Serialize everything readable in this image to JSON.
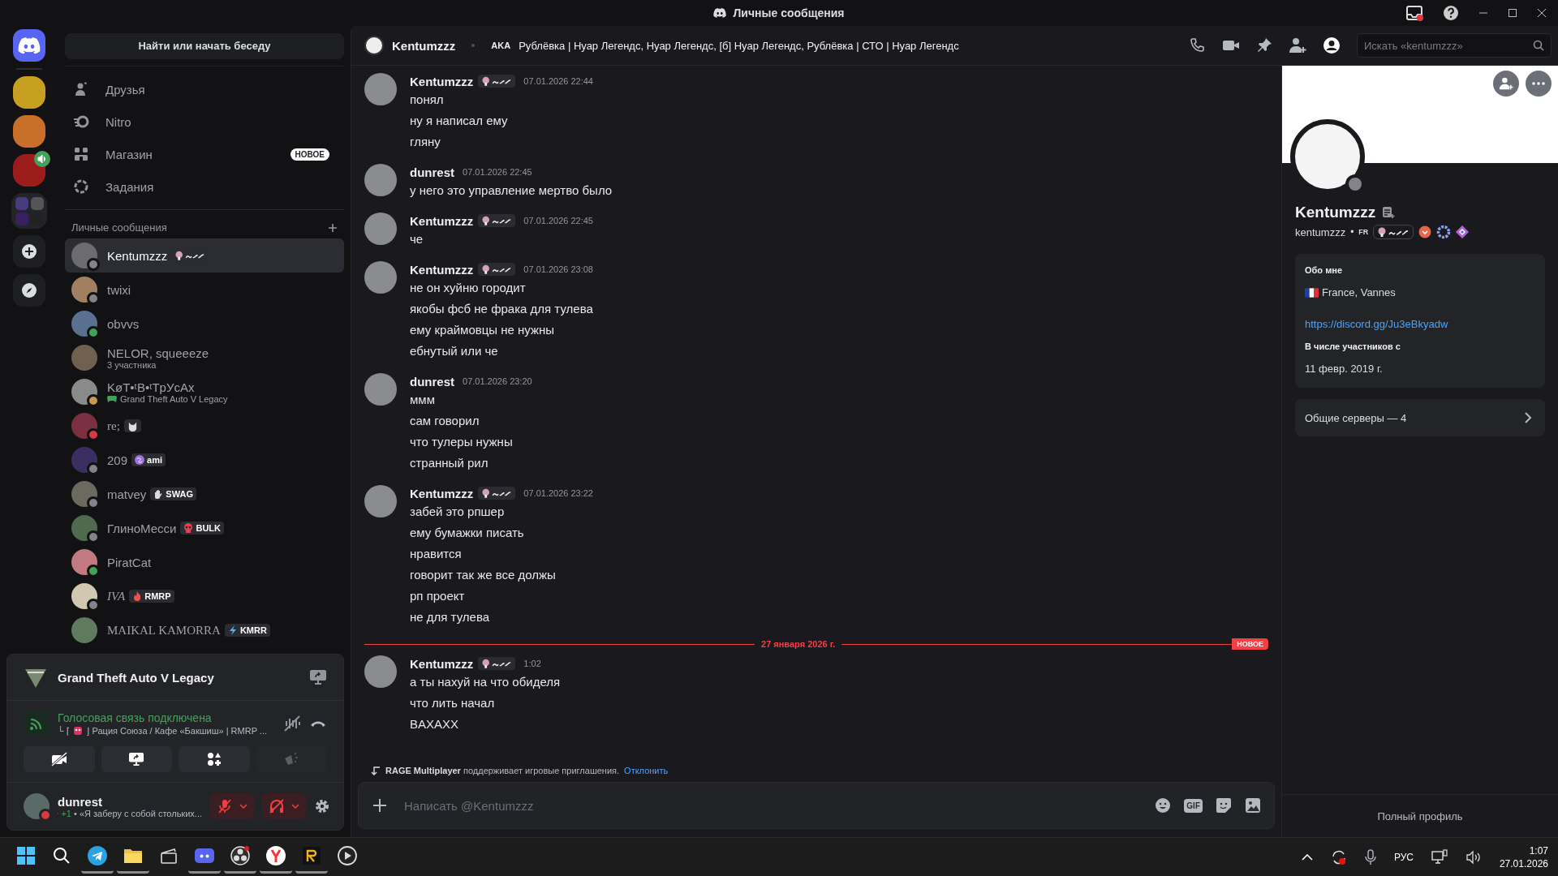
{
  "titlebar": {
    "title": "Личные сообщения"
  },
  "rail": [
    {
      "kind": "home",
      "selected": true
    },
    {
      "kind": "server",
      "selected": false,
      "voice": false
    },
    {
      "kind": "server",
      "selected": false,
      "voice": false
    },
    {
      "kind": "server",
      "selected": false,
      "voice": true
    },
    {
      "kind": "folder",
      "selected": false
    },
    {
      "kind": "add"
    },
    {
      "kind": "explore"
    }
  ],
  "sidebar": {
    "search_button": "Найти или начать беседу",
    "nav": [
      {
        "kind": "friends",
        "label": "Друзья"
      },
      {
        "kind": "nitro",
        "label": "Nitro"
      },
      {
        "kind": "shop",
        "label": "Магазин",
        "badge": "НОВОЕ"
      },
      {
        "kind": "quests",
        "label": "Задания"
      }
    ],
    "dm_header": "Личные сообщения",
    "dms": [
      {
        "kind": "plain",
        "name": "Kentumzzz",
        "tag": {
          "kind": "emblem"
        },
        "color": "#82838b",
        "selected": true
      },
      {
        "kind": "plain",
        "name": "twixi",
        "color": "#82838b",
        "selected": false
      },
      {
        "kind": "plain",
        "name": "obvvs",
        "color": "#43a25a",
        "selected": false
      },
      {
        "kind": "plain",
        "name": "NELOR, squeeeze",
        "subtitle": "3 участника",
        "selected": false
      },
      {
        "kind": "plain",
        "name": "KøT•ᵗB•ᵗTpУcAx",
        "subtitle": "Grand Theft Auto V Legacy",
        "color": "#ca9654",
        "selected": false
      },
      {
        "kind": "serif",
        "name": "re;",
        "tag": {
          "kind": "cat"
        },
        "color": "#d83a42",
        "selected": false
      },
      {
        "kind": "plain",
        "name": "209",
        "tag": {
          "kind": "swirl",
          "label": "ami"
        },
        "color": "#82838b",
        "selected": false
      },
      {
        "kind": "plain",
        "name": "matvey",
        "tag": {
          "kind": "hand",
          "label": "SWAG"
        },
        "color": "#82838b",
        "selected": false
      },
      {
        "kind": "plain",
        "name": "ГлиноМесси",
        "tag": {
          "kind": "skull",
          "label": "BULK"
        },
        "color": "#82838b",
        "selected": false
      },
      {
        "kind": "plain",
        "name": "PiratCat",
        "color": "#43a25a",
        "selected": false
      },
      {
        "kind": "italic",
        "name": "IVA",
        "tag": {
          "kind": "flame",
          "label": "RMRP"
        },
        "color": "#82838b",
        "selected": false
      },
      {
        "kind": "serif",
        "name": "MAIKAL KAMORRA",
        "tag": {
          "kind": "bolt",
          "label": "KMRR"
        },
        "selected": false
      }
    ]
  },
  "activity": {
    "game": "Grand Theft Auto V Legacy",
    "voice_status": "Голосовая связь подключена",
    "channel_prefix": "└ ⌈",
    "channel_suffix": "⌋ Рация Союза / Кафе «Бакшиш» | RMRP ..."
  },
  "user": {
    "name": "dunrest",
    "color": "#d83a42",
    "activity_count": "+1",
    "custom_status": "• «Я заберу с собой стольких...",
    "mic_muted": true,
    "deafened": true
  },
  "chat_header": {
    "name": "Kentumzzz",
    "aka_label": "AKA",
    "aka": "Рублёвка | Нуар Легендс, Нуар Легендс, [б] Нуар Легендс, Рублёвка | СТО | Нуар Легендс",
    "search_placeholder": "Искать «kentumzzz»",
    "profile_open": true
  },
  "messages": [
    {
      "author": "Kentumzzz",
      "tag_emblem": true,
      "time": "07.01.2026 22:44",
      "lines": [
        "понял",
        "ну я написал ему",
        "гляну"
      ]
    },
    {
      "author": "dunrest",
      "tag_emblem": false,
      "time": "07.01.2026 22:45",
      "lines": [
        "у него это управление мертво было"
      ]
    },
    {
      "author": "Kentumzzz",
      "tag_emblem": true,
      "time": "07.01.2026 22:45",
      "lines": [
        "че"
      ]
    },
    {
      "author": "Kentumzzz",
      "tag_emblem": true,
      "time": "07.01.2026 23:08",
      "lines": [
        "не он хуйню городит",
        "якобы фсб не фрака для тулева",
        "ему краймовцы не нужны",
        "ебнутый или че"
      ]
    },
    {
      "author": "dunrest",
      "tag_emblem": false,
      "time": "07.01.2026 23:20",
      "lines": [
        "ммм",
        "сам говорил",
        "что тулеры нужны",
        "странный рил"
      ]
    },
    {
      "author": "Kentumzzz",
      "tag_emblem": true,
      "time": "07.01.2026 23:22",
      "lines": [
        "забей это рпшер",
        "ему бумажки писать",
        "нравится",
        "говорит так же все должы",
        "рп проект",
        "не для тулева"
      ]
    }
  ],
  "divider": {
    "date": "27 января 2026 г.",
    "badge": "НОВОЕ"
  },
  "new_messages": [
    {
      "author": "Kentumzzz",
      "tag_emblem": true,
      "time": "1:02",
      "lines": [
        "а ты нахуй на что обиделя",
        "что лить начал",
        "BAXAXX"
      ]
    }
  ],
  "invite_notice": {
    "text": "**RAGE Multiplayer** поддерживает игровые приглашения.",
    "link": "Отклонить"
  },
  "composer": {
    "placeholder": "Написать @Kentumzzz",
    "gif_label": "GIF"
  },
  "profile": {
    "display_name": "Kentumzzz",
    "username": "kentumzzz",
    "separator": "•",
    "guild_tag": "FR",
    "color": "#82838b",
    "about_title": "Обо мне",
    "location": "France, Vannes",
    "link": "https://discord.gg/Ju3eBkyadw",
    "member_since_title": "В числе участников с",
    "member_since": "11 февр. 2019 г.",
    "mutual_servers": "Общие серверы — 4",
    "full_profile": "Полный профиль"
  },
  "taskbar": {
    "apps": [
      {
        "kind": "start",
        "active": false
      },
      {
        "kind": "search",
        "active": false
      },
      {
        "kind": "telegram",
        "active": true
      },
      {
        "kind": "explorer",
        "active": true
      },
      {
        "kind": "app",
        "active": false
      },
      {
        "kind": "discord",
        "active": true
      },
      {
        "kind": "obs",
        "active": true
      },
      {
        "kind": "yandex",
        "active": true
      },
      {
        "kind": "rage",
        "active": true
      },
      {
        "kind": "player",
        "active": false
      }
    ],
    "language": "РУС",
    "time": "1:07",
    "date": "27.01.2026"
  }
}
